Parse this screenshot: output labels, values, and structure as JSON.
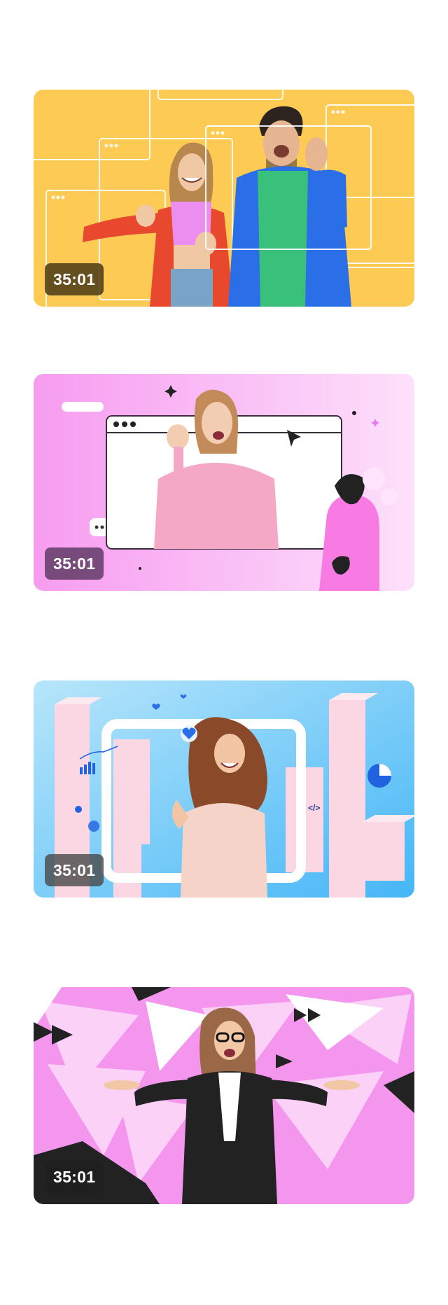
{
  "videos": [
    {
      "duration": "35:01",
      "theme": "yellow",
      "colors": {
        "background": "#fdca54",
        "badge": "rgba(74,58,22,0.85)"
      }
    },
    {
      "duration": "35:01",
      "theme": "pink",
      "colors": {
        "background": "#f79cf0",
        "badge": "rgba(92,55,98,0.82)"
      }
    },
    {
      "duration": "35:01",
      "theme": "blue",
      "colors": {
        "background": "#5ac3f7",
        "badge": "rgba(72,72,72,0.8)"
      }
    },
    {
      "duration": "35:01",
      "theme": "magenta",
      "colors": {
        "background": "#f596ee",
        "badge": "rgba(30,30,30,0.85)"
      }
    }
  ],
  "icons": [
    "play-icon",
    "cursor-arrow-icon",
    "chat-dots-icon",
    "heart-icon",
    "code-icon",
    "pie-chart-icon",
    "bar-chart-icon"
  ]
}
